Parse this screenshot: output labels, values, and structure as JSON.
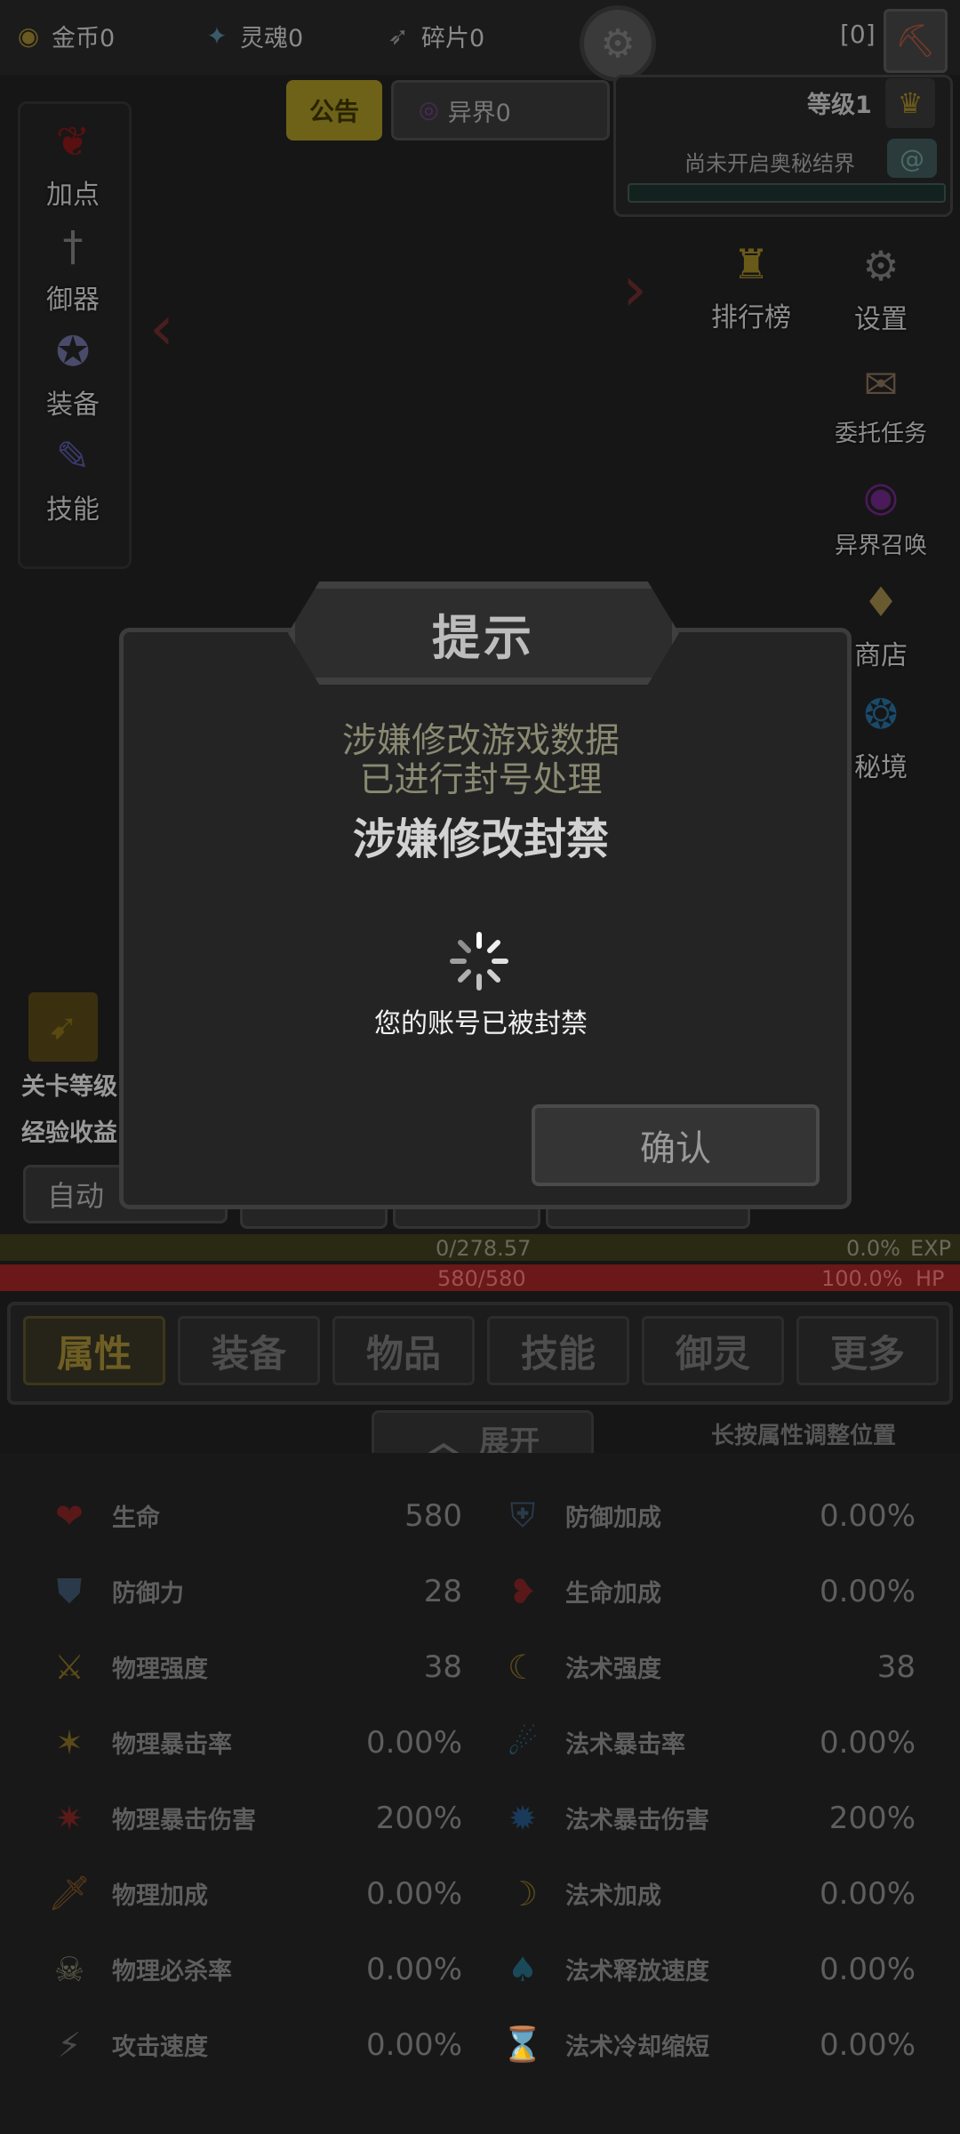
{
  "topbar": {
    "gold": "金币0",
    "soul": "灵魂0",
    "fragment": "碎片0",
    "bracket": "[0]"
  },
  "notice_tab": "公告",
  "otherworld_tab": "异界0",
  "level": "等级1",
  "mystic_status": "尚未开启奥秘结界",
  "left_menu": [
    "加点",
    "御器",
    "装备",
    "技能"
  ],
  "right_menu": [
    "设置",
    "委托任务",
    "异界召唤",
    "商店",
    "秘境"
  ],
  "rank_label": "排行榜",
  "dialog": {
    "title": "提示",
    "line1": "涉嫌修改游戏数据",
    "line2": "已进行封号处理",
    "line3": "涉嫌修改封禁",
    "toast": "您的账号已被封禁",
    "confirm": "确认"
  },
  "stage": {
    "level_label": "关卡等级",
    "exp_label": "经验收益",
    "auto_label": "自动"
  },
  "bars": {
    "exp_value": "0/278.57",
    "exp_percent": "0.0%",
    "exp_label": "EXP",
    "hp_value": "580/580",
    "hp_percent": "100.0%",
    "hp_label": "HP"
  },
  "tabs": [
    "属性",
    "装备",
    "物品",
    "技能",
    "御灵",
    "更多"
  ],
  "expand_label": "展开",
  "hint": "长按属性调整位置",
  "stats_left": [
    {
      "name": "生命",
      "value": "580"
    },
    {
      "name": "防御力",
      "value": "28"
    },
    {
      "name": "物理强度",
      "value": "38"
    },
    {
      "name": "物理暴击率",
      "value": "0.00%"
    },
    {
      "name": "物理暴击伤害",
      "value": "200%"
    },
    {
      "name": "物理加成",
      "value": "0.00%"
    },
    {
      "name": "物理必杀率",
      "value": "0.00%"
    },
    {
      "name": "攻击速度",
      "value": "0.00%"
    }
  ],
  "stats_right": [
    {
      "name": "防御加成",
      "value": "0.00%"
    },
    {
      "name": "生命加成",
      "value": "0.00%"
    },
    {
      "name": "法术强度",
      "value": "38"
    },
    {
      "name": "法术暴击率",
      "value": "0.00%"
    },
    {
      "name": "法术暴击伤害",
      "value": "200%"
    },
    {
      "name": "法术加成",
      "value": "0.00%"
    },
    {
      "name": "法术释放速度",
      "value": "0.00%"
    },
    {
      "name": "法术冷却缩短",
      "value": "0.00%"
    }
  ]
}
